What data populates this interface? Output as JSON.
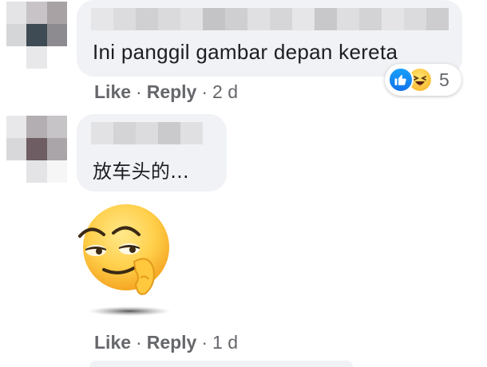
{
  "comments": [
    {
      "text": "Ini panggil gambar depan kereta",
      "actions": {
        "like": "Like",
        "separator": "·",
        "reply": "Reply",
        "time": "2 d"
      },
      "reactions": {
        "icons": [
          "like-icon",
          "haha-icon"
        ],
        "count": "5"
      }
    },
    {
      "text": "放车头的...",
      "sticker": "smirking-face-sticker",
      "actions": {
        "like": "Like",
        "separator": "·",
        "reply": "Reply",
        "time": "1 d"
      }
    }
  ],
  "colors": {
    "bubble": "#f0f2f5",
    "text": "#1c1e21",
    "secondary_text": "#65676b",
    "like_blue": "#1877f2",
    "haha_yellow": "#f7b125"
  }
}
